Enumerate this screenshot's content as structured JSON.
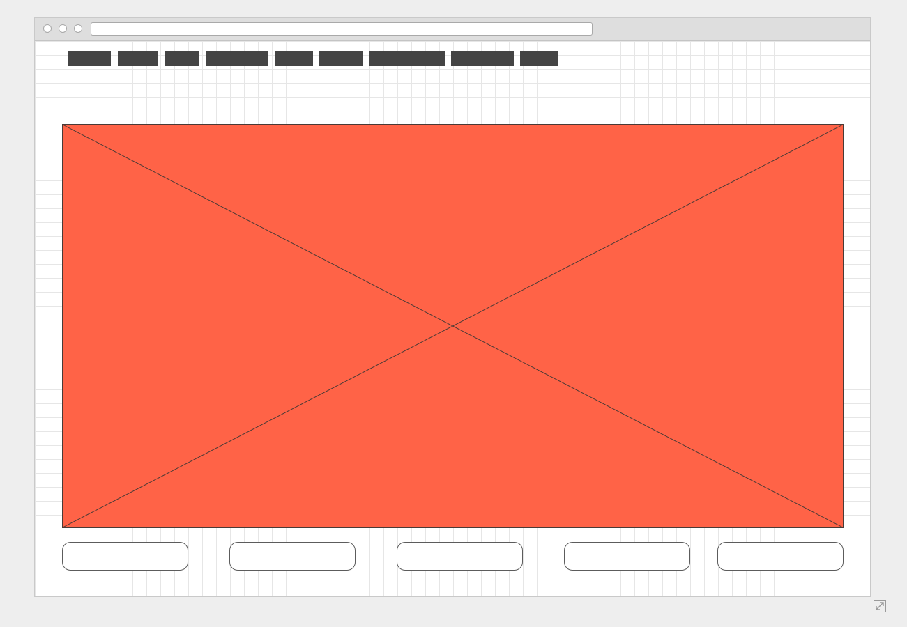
{
  "browser": {
    "address": ""
  },
  "nav": {
    "tabs": [
      {
        "label": ""
      },
      {
        "label": ""
      },
      {
        "label": ""
      },
      {
        "label": ""
      },
      {
        "label": ""
      },
      {
        "label": ""
      },
      {
        "label": ""
      },
      {
        "label": ""
      },
      {
        "label": ""
      }
    ]
  },
  "hero": {
    "fill_color": "#ff6347",
    "icon": "image-placeholder-icon"
  },
  "buttons": [
    {
      "label": ""
    },
    {
      "label": ""
    },
    {
      "label": ""
    },
    {
      "label": ""
    },
    {
      "label": ""
    }
  ],
  "colors": {
    "nav_tab": "#444444",
    "page_background": "#eeeeee",
    "grid_line": "#e6e6e6"
  },
  "icons": {
    "window_controls": [
      "window-close-icon",
      "window-minimize-icon",
      "window-zoom-icon"
    ],
    "corner": "expand-icon"
  }
}
